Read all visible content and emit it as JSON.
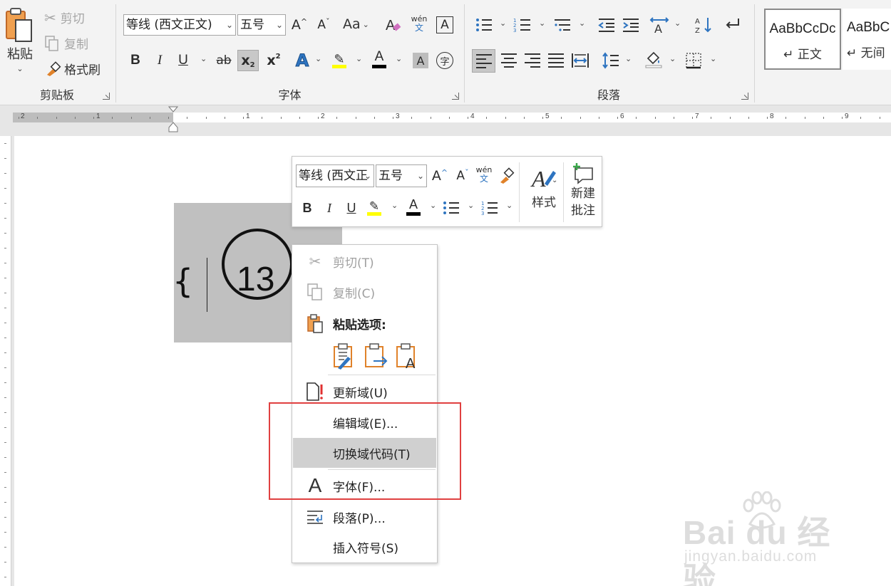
{
  "ribbon": {
    "clipboard": {
      "label": "剪贴板",
      "paste": "粘贴",
      "cut": "剪切",
      "copy": "复制",
      "format_painter": "格式刷"
    },
    "font": {
      "label": "字体",
      "font_name": "等线 (西文正文)",
      "font_size": "五号",
      "change_case": "Aa",
      "phonetic_top": "wén",
      "phonetic_bottom": "文",
      "border_char": "A",
      "bold": "B",
      "italic": "I",
      "underline": "U",
      "strike": "ab",
      "subscript": "x",
      "superscript": "x",
      "text_effect": "A",
      "font_color": "A",
      "char_shading": "A",
      "enclose": "字",
      "highlight_color": "#ffff00",
      "font_color_value": "#000000"
    },
    "paragraph": {
      "label": "段落"
    },
    "styles": [
      {
        "sample": "AaBbCcDc",
        "name": "↵ 正文"
      },
      {
        "sample": "AaBbC",
        "name": "↵ 无间"
      }
    ]
  },
  "ruler": {
    "left_numbers": [
      "2",
      "1"
    ],
    "right_numbers": [
      "1",
      "2",
      "3",
      "4",
      "5",
      "6",
      "7",
      "8",
      "9"
    ]
  },
  "document": {
    "brace": "{",
    "circled_number": "13"
  },
  "mini_toolbar": {
    "font_name": "等线 (西文正",
    "font_size": "五号",
    "bold": "B",
    "italic": "I",
    "underline": "U",
    "styles": "样式",
    "new_comment_line1": "新建",
    "new_comment_line2": "批注",
    "phonetic_top": "wén",
    "phonetic_bottom": "文"
  },
  "context_menu": {
    "items": [
      {
        "label": "剪切(T)",
        "enabled": false
      },
      {
        "label": "复制(C)",
        "enabled": false
      },
      {
        "label": "粘贴选项:",
        "enabled": true
      },
      {
        "label": "更新域(U)",
        "enabled": true
      },
      {
        "label": "编辑域(E)...",
        "enabled": true
      },
      {
        "label": "切换域代码(T)",
        "enabled": true,
        "hovered": true
      },
      {
        "label": "字体(F)...",
        "enabled": true
      },
      {
        "label": "段落(P)...",
        "enabled": true
      },
      {
        "label": "插入符号(S)",
        "enabled": true
      }
    ]
  },
  "colors": {
    "highlight_box": "#e04040",
    "field_selection": "#c0c0c0",
    "accent_orange": "#e0822a",
    "accent_blue": "#2e74c0"
  },
  "watermark": {
    "brand": "Bai du 经验",
    "url": "jingyan.baidu.com"
  }
}
